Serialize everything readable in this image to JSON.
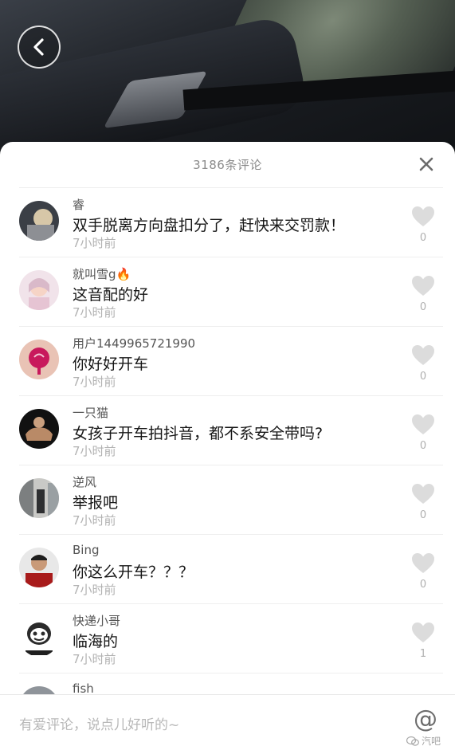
{
  "sheet": {
    "title": "3186条评论"
  },
  "comments": [
    {
      "user": "睿",
      "text": "双手脱离方向盘扣分了，赶快来交罚款！",
      "time": "7小时前",
      "likes": "0",
      "avatar": "avatar-dark-blonde"
    },
    {
      "user": "就叫雪g🔥",
      "text": "这音配的好",
      "time": "7小时前",
      "likes": "0",
      "avatar": "avatar-pink-selfie"
    },
    {
      "user": "用户1449965721990",
      "text": "你好好开车",
      "time": "7小时前",
      "likes": "0",
      "avatar": "avatar-pink-flower"
    },
    {
      "user": "一只猫",
      "text": "女孩子开车拍抖音，都不系安全带吗?",
      "time": "7小时前",
      "likes": "0",
      "avatar": "avatar-muscle"
    },
    {
      "user": "逆风",
      "text": "举报吧",
      "time": "7小时前",
      "likes": "0",
      "avatar": "avatar-street"
    },
    {
      "user": "Bing",
      "text": "你这么开车？？？",
      "time": "7小时前",
      "likes": "0",
      "avatar": "avatar-man-red"
    },
    {
      "user": "快递小哥",
      "text": "临海的",
      "time": "7小时前",
      "likes": "1",
      "avatar": "avatar-meme-face"
    }
  ],
  "partial_comment": {
    "user": "fish"
  },
  "input": {
    "placeholder": "有爱评论，说点儿好听的~"
  },
  "at_button": "@",
  "watermark": "汽吧",
  "colors": {
    "heart": "#dcdcdc",
    "muted_text": "#b2b2b2",
    "primary_text": "#161616"
  }
}
